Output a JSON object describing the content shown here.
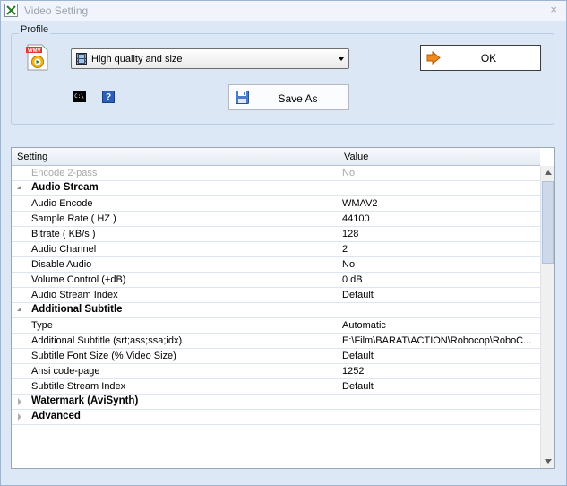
{
  "window": {
    "title": "Video Setting",
    "close_glyph": "×"
  },
  "profile": {
    "group_label": "Profile",
    "selected": "High quality and size",
    "ok_label": "OK",
    "save_as_label": "Save As",
    "cmd_icon_text": "C:\\",
    "help_icon_text": "?"
  },
  "grid": {
    "headers": {
      "setting": "Setting",
      "value": "Value"
    },
    "rows": [
      {
        "kind": "prop",
        "name": "Encode 2-pass",
        "value": "No",
        "disabled": true
      },
      {
        "kind": "cat",
        "name": "Audio Stream",
        "expanded": true
      },
      {
        "kind": "prop",
        "name": "Audio Encode",
        "value": "WMAV2"
      },
      {
        "kind": "prop",
        "name": "Sample Rate ( HZ )",
        "value": "44100"
      },
      {
        "kind": "prop",
        "name": "Bitrate ( KB/s )",
        "value": "128"
      },
      {
        "kind": "prop",
        "name": "Audio Channel",
        "value": "2"
      },
      {
        "kind": "prop",
        "name": "Disable Audio",
        "value": "No"
      },
      {
        "kind": "prop",
        "name": "Volume Control (+dB)",
        "value": "0 dB"
      },
      {
        "kind": "prop",
        "name": "Audio Stream Index",
        "value": "Default"
      },
      {
        "kind": "cat",
        "name": "Additional Subtitle",
        "expanded": true
      },
      {
        "kind": "prop",
        "name": "Type",
        "value": "Automatic"
      },
      {
        "kind": "prop",
        "name": "Additional Subtitle (srt;ass;ssa;idx)",
        "value": "E:\\Film\\BARAT\\ACTION\\Robocop\\RoboC..."
      },
      {
        "kind": "prop",
        "name": "Subtitle Font Size (% Video Size)",
        "value": "Default"
      },
      {
        "kind": "prop",
        "name": "Ansi code-page",
        "value": "1252"
      },
      {
        "kind": "prop",
        "name": "Subtitle Stream Index",
        "value": "Default"
      },
      {
        "kind": "cat",
        "name": "Watermark (AviSynth)",
        "expanded": false
      },
      {
        "kind": "cat",
        "name": "Advanced",
        "expanded": false
      }
    ]
  },
  "colors": {
    "window_bg": "#dce8f6",
    "disabled_text": "#a8a8a8",
    "ok_arrow": "#f08a1c"
  }
}
